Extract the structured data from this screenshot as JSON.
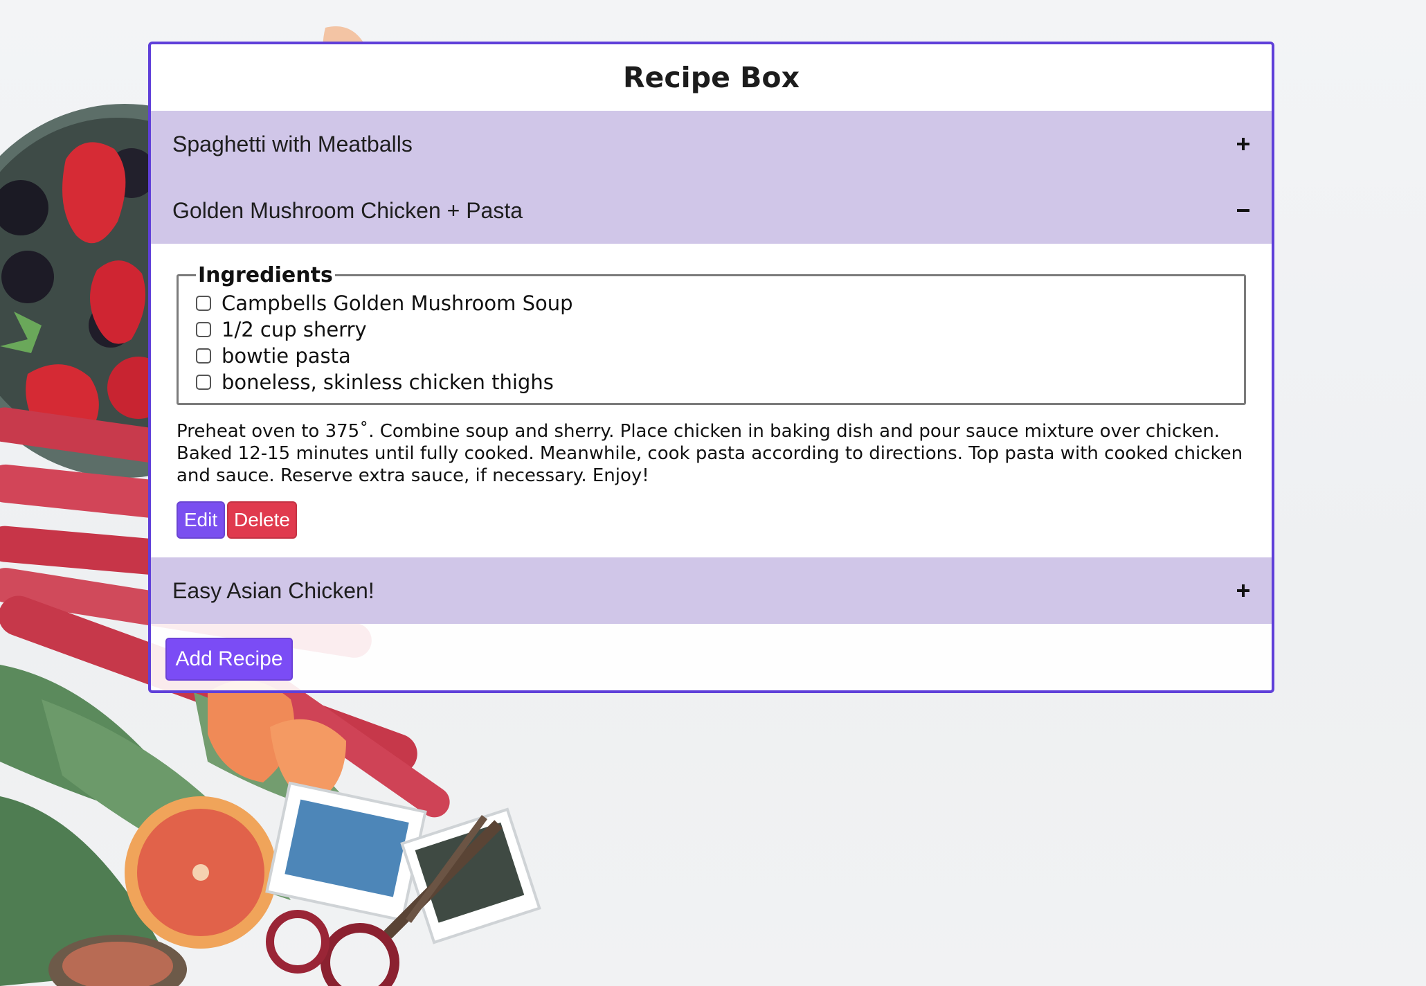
{
  "app": {
    "title": "Recipe Box"
  },
  "recipes": [
    {
      "name": "Spaghetti with Meatballs",
      "expanded": false,
      "toggle_icon": "plus-icon"
    },
    {
      "name": "Golden Mushroom Chicken + Pasta",
      "expanded": true,
      "toggle_icon": "minus-icon",
      "ingredients_label": "Ingredients",
      "ingredients": [
        "Campbells Golden Mushroom Soup",
        "1/2 cup sherry",
        "bowtie pasta",
        "boneless, skinless chicken thighs"
      ],
      "instructions": "Preheat oven to 375˚. Combine soup and sherry. Place chicken in baking dish and pour sauce mixture over chicken. Baked 12-15 minutes until fully cooked. Meanwhile, cook pasta according to directions. Top pasta with cooked chicken and sauce. Reserve extra sauce, if necessary. Enjoy!",
      "edit_label": "Edit",
      "delete_label": "Delete"
    },
    {
      "name": "Easy Asian Chicken!",
      "expanded": false,
      "toggle_icon": "plus-icon"
    }
  ],
  "footer": {
    "add_label": "Add Recipe"
  },
  "colors": {
    "card_border": "#5f3fd9",
    "header_bg": "#d0c6e8",
    "edit_button": "#7a4ff0",
    "delete_button": "#e03a4e",
    "add_button": "#7b4cf5"
  }
}
